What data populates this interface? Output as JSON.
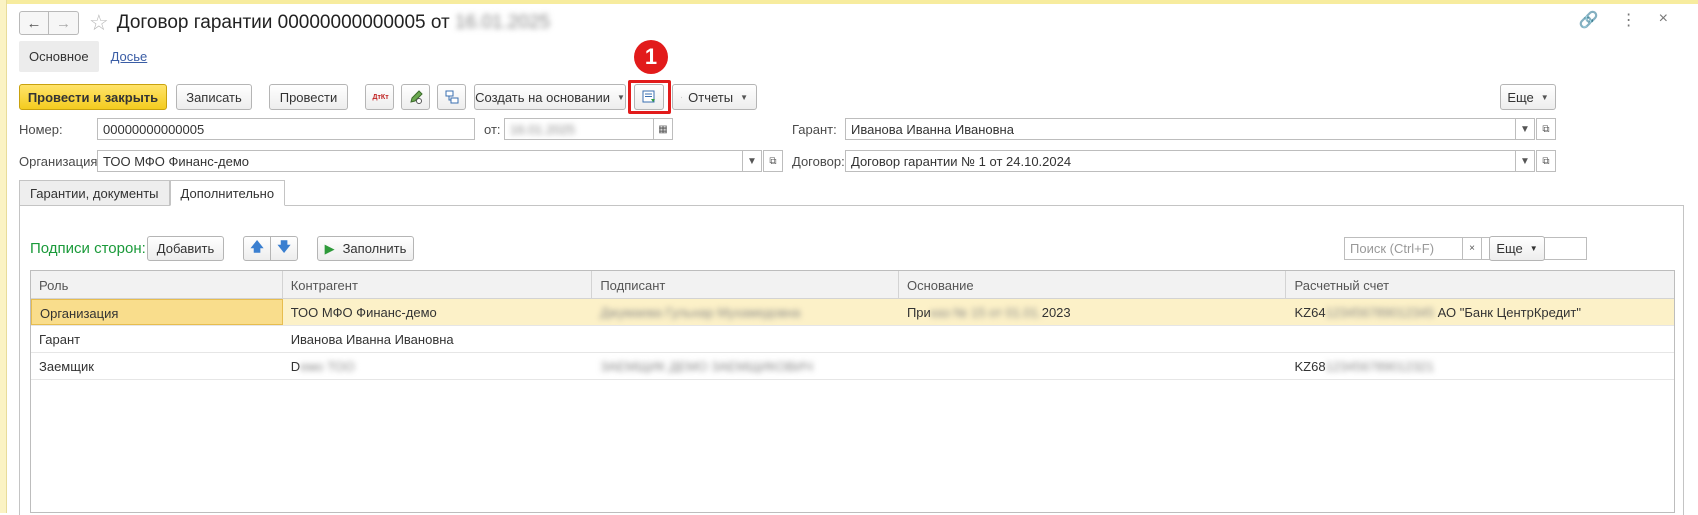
{
  "window": {
    "title_prefix": "Договор гарантии 00000000000005 от",
    "title_date_blurred": "16.01.2025"
  },
  "sections": {
    "main": "Основное",
    "dossier": "Досье"
  },
  "toolbar": {
    "post_close": "Провести и закрыть",
    "save": "Записать",
    "post": "Провести",
    "dt_kt_glyph": "ДтКт",
    "create_based_on": "Создать на основании",
    "reports": "Отчеты",
    "more": "Еще"
  },
  "callout": {
    "number": "1"
  },
  "fields": {
    "number_label": "Номер:",
    "number_value": "00000000000005",
    "date_label": "от:",
    "date_blurred": "16.01.2025",
    "guarantor_label": "Гарант:",
    "guarantor_value": "Иванова Иванна Ивановна",
    "organization_label": "Организация:",
    "organization_value": "ТОО МФО Финанс-демо",
    "contract_label": "Договор:",
    "contract_value": "Договор гарантии № 1 от 24.10.2024"
  },
  "tabs": [
    {
      "label": "Гарантии, документы",
      "active": false
    },
    {
      "label": "Дополнительно",
      "active": true
    }
  ],
  "signers": {
    "title": "Подписи сторон:",
    "add": "Добавить",
    "fill": "Заполнить",
    "search_placeholder": "Поиск (Ctrl+F)",
    "clear": "×",
    "more": "Еще",
    "columns": [
      "Роль",
      "Контрагент",
      "Подписант",
      "Основание",
      "Расчетный счет"
    ],
    "rows": [
      {
        "role": "Организация",
        "counterparty": "ТОО МФО Финанс-демо",
        "signer_blurred": "Джумаева Гульнар Мухамедовна",
        "basis_start": "При",
        "basis_blurred": "каз № 15 от 01.01.",
        "basis_end": "2023",
        "account_start": "KZ64",
        "account_blurred": "123456789012345",
        "account_end": "АО \"Банк ЦентрКредит\""
      },
      {
        "role": "Гарант",
        "counterparty": "Иванова Иванна Ивановна",
        "signer_blurred": "",
        "basis_start": "",
        "basis_blurred": "",
        "basis_end": "",
        "account_start": "",
        "account_blurred": "",
        "account_end": ""
      },
      {
        "role": "Заемщик",
        "counterparty_start": "D",
        "counterparty_blurred": "емо ТОО",
        "signer_blurred": "ЗАЕМЩИК ДЕМО ЗАЕМЩИКОВИЧ",
        "basis_start": "",
        "basis_blurred": "",
        "basis_end": "",
        "account_start": "KZ68",
        "account_blurred": "123456789012321",
        "account_end": ""
      }
    ]
  },
  "colors": {
    "primary_button": "#f4cc1f",
    "accent_green": "#1a9a3a",
    "callout_red": "#e21b1b",
    "selected_row": "#fcf1c8"
  }
}
